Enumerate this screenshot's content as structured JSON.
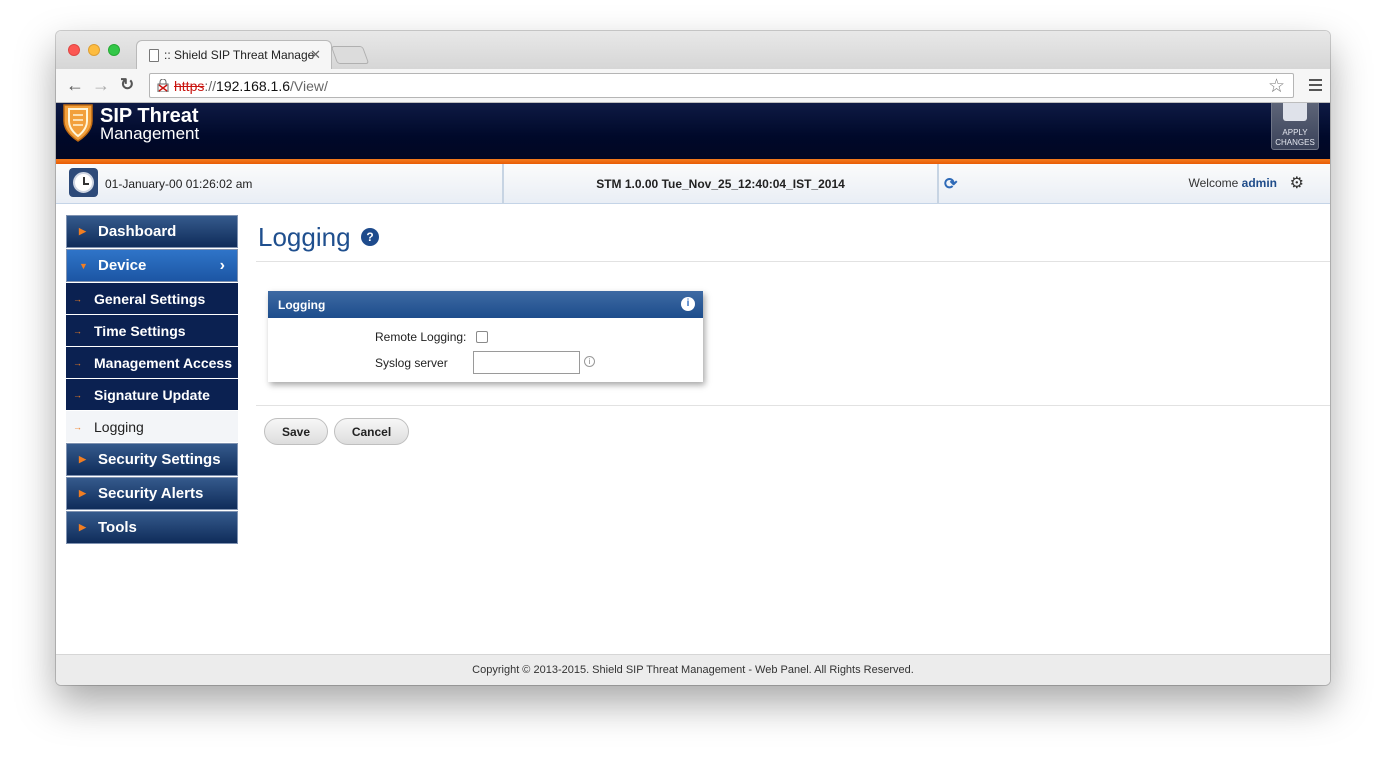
{
  "browser": {
    "tab_title": ":: Shield SIP Threat Management",
    "tab_close": "✕",
    "url_scheme": "https",
    "url_sep": "://",
    "url_host": "192.168.1.6",
    "url_path": "/View/"
  },
  "header": {
    "brand_line1": "SIP Threat",
    "brand_line2": "Management",
    "apply_line1": "APPLY",
    "apply_line2": "CHANGES"
  },
  "status": {
    "datetime": "01-January-00  01:26:02 am",
    "version": "STM 1.0.00 Tue_Nov_25_12:40:04_IST_2014",
    "welcome_prefix": "Welcome",
    "username": "admin"
  },
  "sidebar": {
    "items": [
      {
        "label": "Dashboard"
      },
      {
        "label": "Device"
      },
      {
        "label": "General Settings"
      },
      {
        "label": "Time Settings"
      },
      {
        "label": "Management Access"
      },
      {
        "label": "Signature Update"
      },
      {
        "label": "Logging"
      },
      {
        "label": "Security Settings"
      },
      {
        "label": "Security Alerts"
      },
      {
        "label": "Tools"
      }
    ]
  },
  "main": {
    "title": "Logging",
    "panel": {
      "title": "Logging",
      "remote_logging_label": "Remote Logging:",
      "remote_logging_checked": false,
      "syslog_label": "Syslog server",
      "syslog_value": ""
    },
    "save_label": "Save",
    "cancel_label": "Cancel"
  },
  "footer": {
    "text": "Copyright © 2013-2015. Shield SIP Threat Management - Web Panel. All Rights Reserved."
  },
  "colors": {
    "accent_blue": "#1f4f8e",
    "nav_dark": "#0b2151",
    "orange": "#f17e22"
  }
}
